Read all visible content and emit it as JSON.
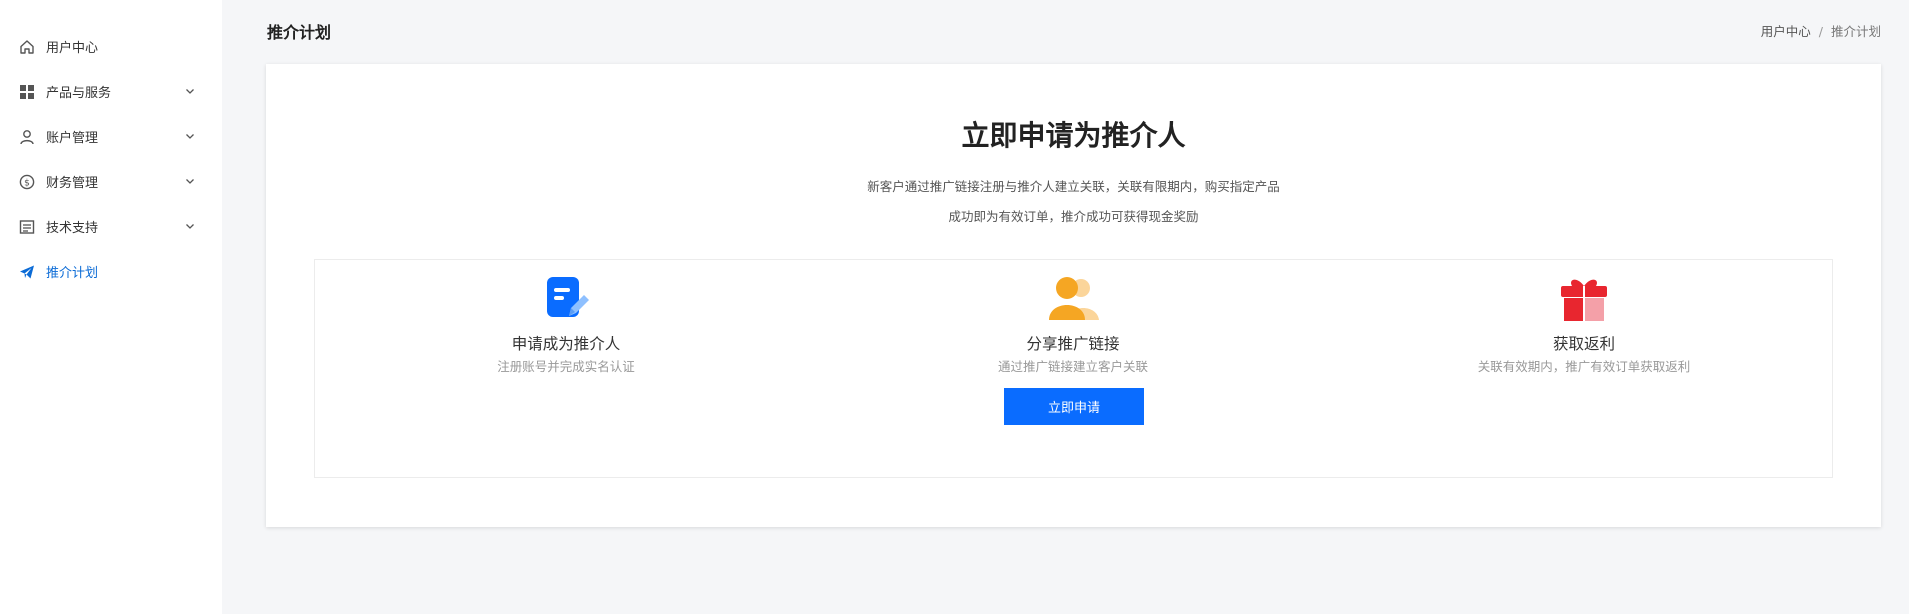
{
  "sidebar": {
    "items": [
      {
        "label": "用户中心",
        "icon": "home-icon",
        "expandable": false,
        "active": false
      },
      {
        "label": "产品与服务",
        "icon": "grid-icon",
        "expandable": true,
        "active": false
      },
      {
        "label": "账户管理",
        "icon": "user-icon",
        "expandable": true,
        "active": false
      },
      {
        "label": "财务管理",
        "icon": "dollar-circle-icon",
        "expandable": true,
        "active": false
      },
      {
        "label": "技术支持",
        "icon": "document-icon",
        "expandable": true,
        "active": false
      },
      {
        "label": "推介计划",
        "icon": "paper-plane-icon",
        "expandable": false,
        "active": true
      }
    ]
  },
  "header": {
    "title": "推介计划",
    "breadcrumb": {
      "root": "用户中心",
      "separator": "/",
      "current": "推介计划"
    }
  },
  "hero": {
    "title": "立即申请为推介人",
    "desc_line1": "新客户通过推广链接注册与推介人建立关联，关联有限期内，购买指定产品",
    "desc_line2": "成功即为有效订单，推介成功可获得现金奖励"
  },
  "steps": [
    {
      "title": "申请成为推介人",
      "desc": "注册账号并完成实名认证",
      "icon": "edit-document-icon"
    },
    {
      "title": "分享推广链接",
      "desc": "通过推广链接建立客户关联",
      "icon": "users-icon"
    },
    {
      "title": "获取返利",
      "desc": "关联有效期内，推广有效订单获取返利",
      "icon": "gift-icon"
    }
  ],
  "apply_button": {
    "label": "立即申请"
  },
  "colors": {
    "accent": "#0a6cff",
    "active_nav": "#0b6bd6",
    "orange": "#f5a623",
    "red": "#e8262f"
  }
}
